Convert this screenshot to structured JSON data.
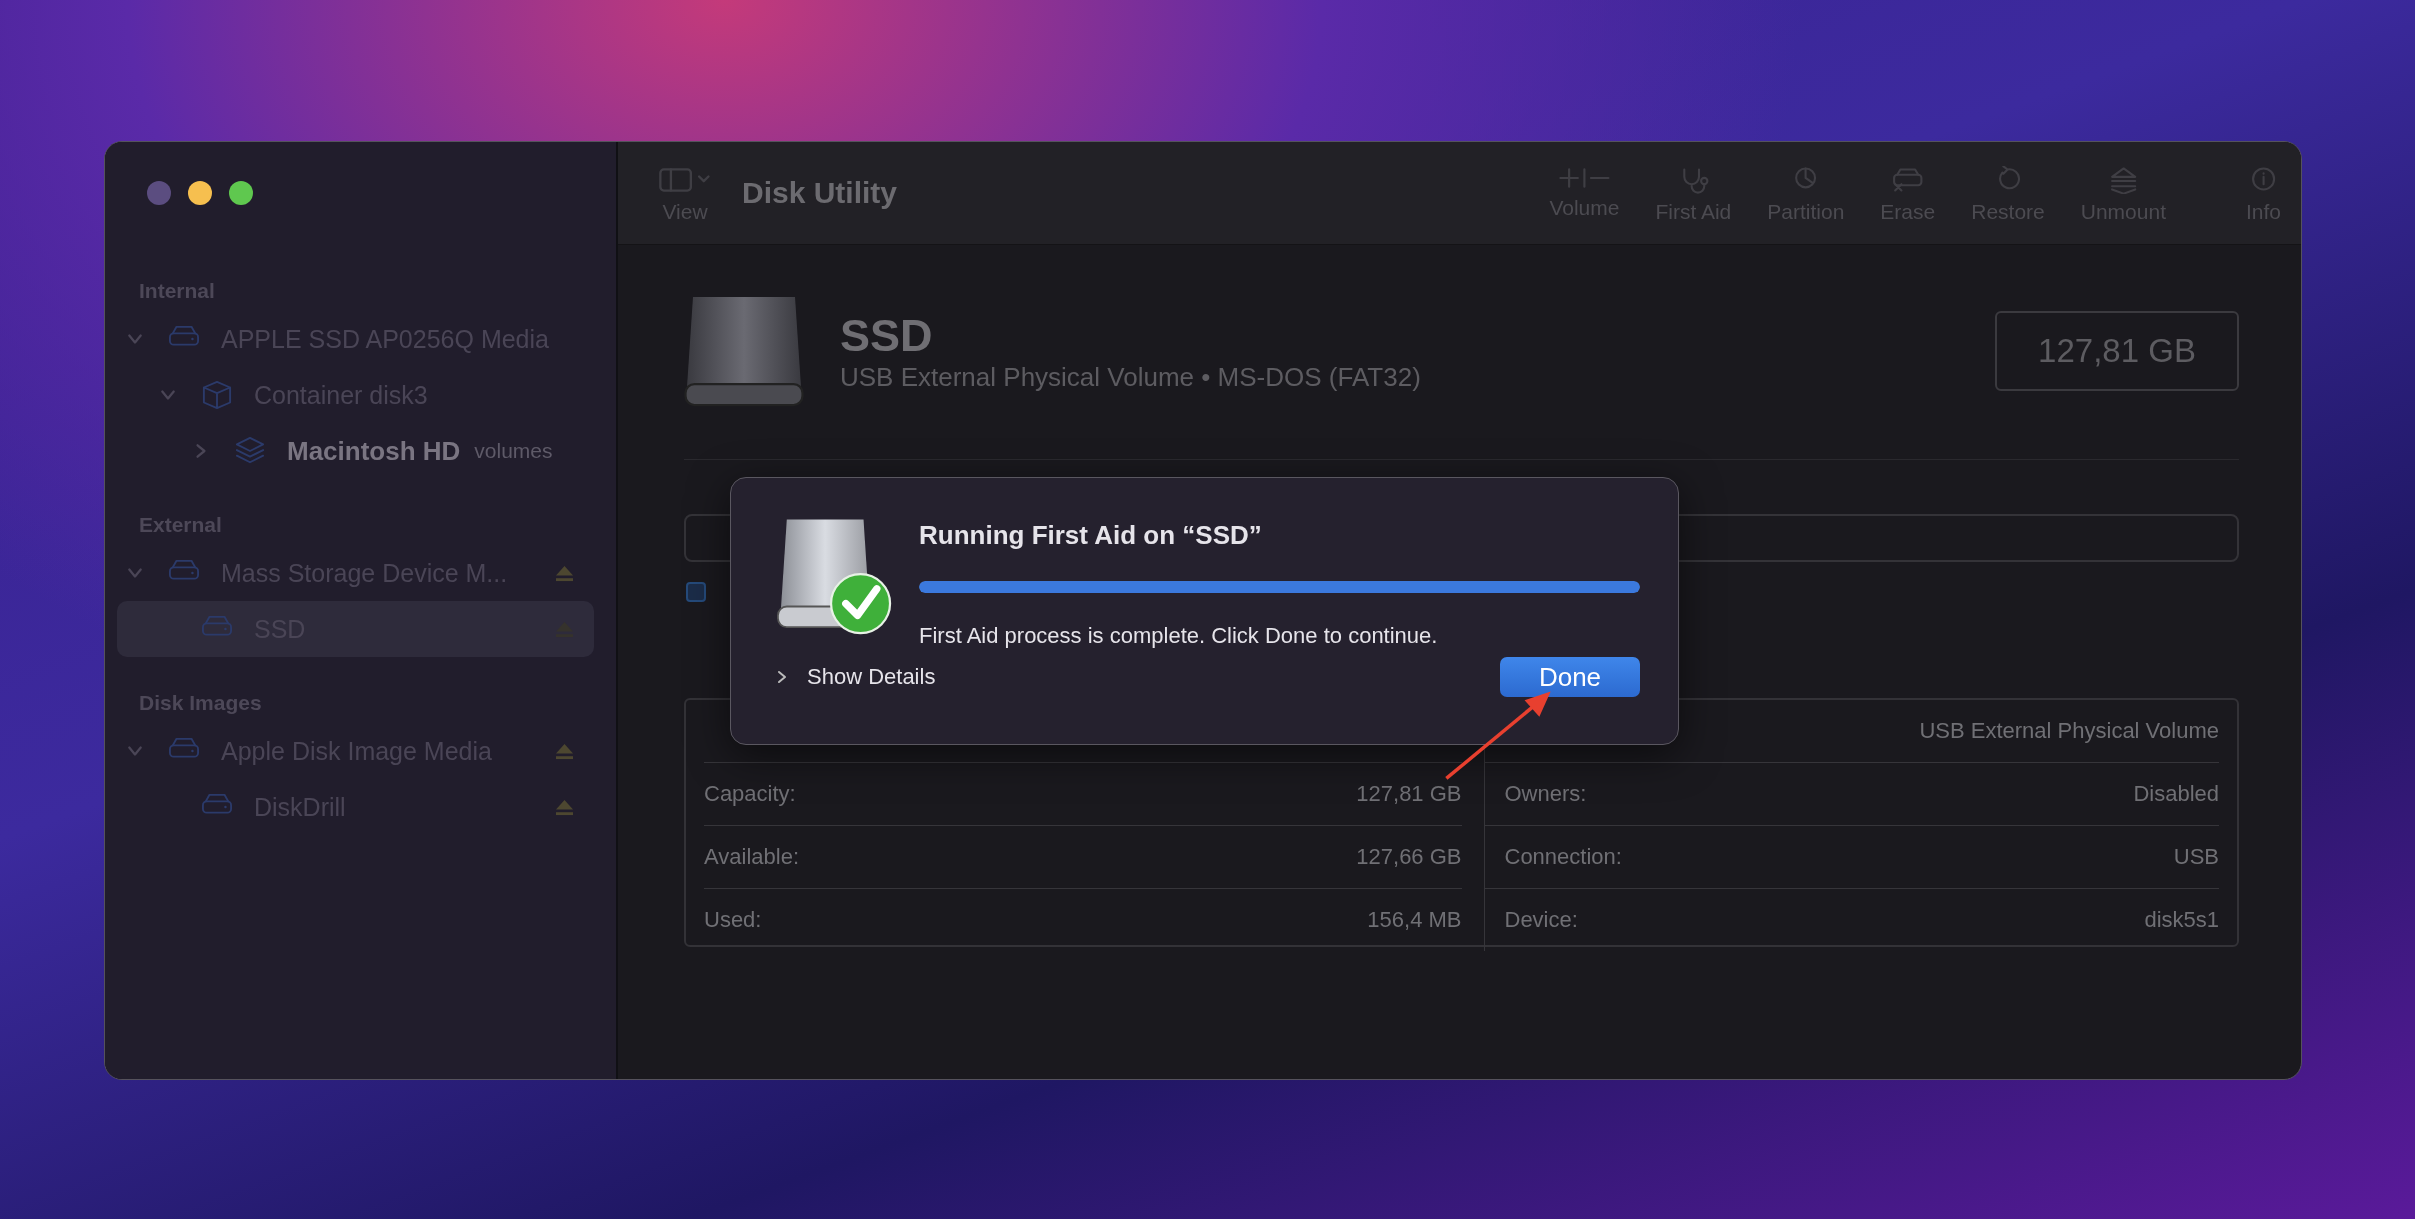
{
  "window": {
    "title": "Disk Utility"
  },
  "toolbar": {
    "view_label": "View",
    "buttons": [
      {
        "label": "Volume",
        "kind": "plus-minus"
      },
      {
        "label": "First Aid",
        "kind": "stethoscope"
      },
      {
        "label": "Partition",
        "kind": "pie"
      },
      {
        "label": "Erase",
        "kind": "erase"
      },
      {
        "label": "Restore",
        "kind": "restore"
      },
      {
        "label": "Unmount",
        "kind": "unmount"
      },
      {
        "label": "Info",
        "kind": "info"
      }
    ]
  },
  "sidebar": {
    "sections": [
      {
        "title": "Internal",
        "items": [
          {
            "label": "APPLE SSD AP0256Q Media",
            "kind": "drive",
            "expanded": true,
            "selected": false,
            "eject": false,
            "children": [
              {
                "label": "Container disk3",
                "kind": "container",
                "expanded": true,
                "selected": false,
                "eject": false,
                "children": [
                  {
                    "label": "Macintosh HD",
                    "suffix": "volumes",
                    "kind": "volumes",
                    "expanded": false,
                    "selected": false,
                    "eject": false
                  }
                ]
              }
            ]
          }
        ]
      },
      {
        "title": "External",
        "items": [
          {
            "label": "Mass Storage Device M...",
            "kind": "drive",
            "expanded": true,
            "selected": false,
            "eject": true,
            "children": [
              {
                "label": "SSD",
                "kind": "drive",
                "selected": true,
                "eject": true
              }
            ]
          }
        ]
      },
      {
        "title": "Disk Images",
        "items": [
          {
            "label": "Apple Disk Image Media",
            "kind": "drive",
            "expanded": true,
            "selected": false,
            "eject": true,
            "children": [
              {
                "label": "DiskDrill",
                "kind": "drive",
                "selected": false,
                "eject": true
              }
            ]
          }
        ]
      }
    ]
  },
  "volume": {
    "name": "SSD",
    "description": "USB External Physical Volume • MS-DOS (FAT32)",
    "size": "127,81 GB"
  },
  "info": {
    "rows": [
      {
        "right_value": "USB External Physical Volume"
      },
      {
        "left_label": "Capacity:",
        "left_value": "127,81 GB",
        "right_label": "Owners:",
        "right_value": "Disabled"
      },
      {
        "left_label": "Available:",
        "left_value": "127,66 GB",
        "right_label": "Connection:",
        "right_value": "USB"
      },
      {
        "left_label": "Used:",
        "left_value": "156,4 MB",
        "right_label": "Device:",
        "right_value": "disk5s1"
      }
    ]
  },
  "dialog": {
    "title": "Running First Aid on “SSD”",
    "level": 1,
    "message": "First Aid process is complete. Click Done to continue.",
    "details_label": "Show Details",
    "expanded": false,
    "button": "Done"
  }
}
